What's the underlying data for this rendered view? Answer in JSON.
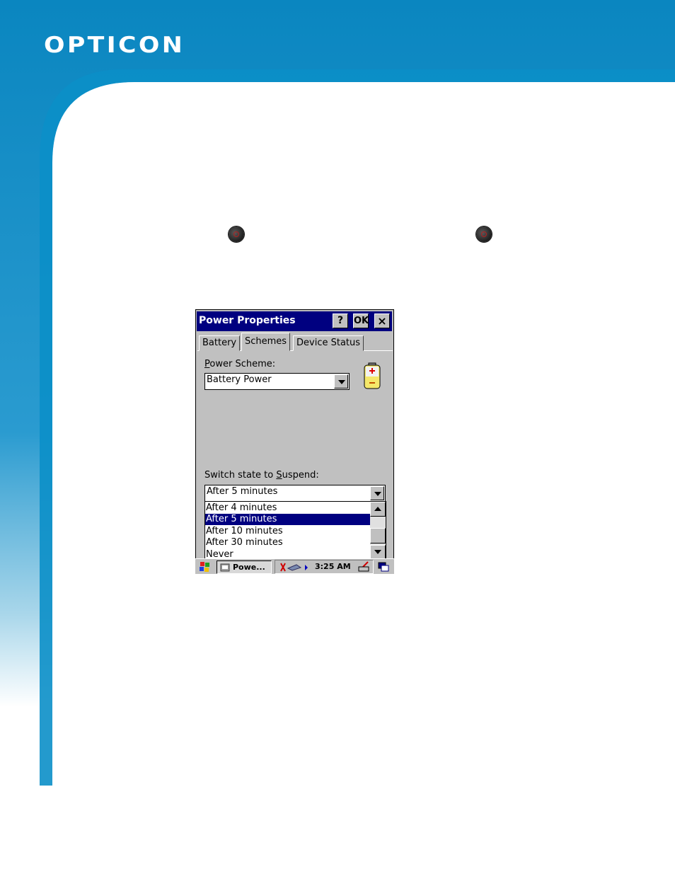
{
  "brand": {
    "logo_text": "OPTICON",
    "primary_color": "#1f8bc2",
    "dark_color": "#0a78b5"
  },
  "window": {
    "title": "Power Properties",
    "help_button": "?",
    "ok_button": "OK",
    "close_button": "×"
  },
  "tabs": [
    {
      "label": "Battery",
      "active": false
    },
    {
      "label": "Schemes",
      "active": true
    },
    {
      "label": "Device Status",
      "active": false
    }
  ],
  "power_scheme": {
    "label_prefix": "",
    "label_hotkey": "P",
    "label_rest": "ower Scheme:",
    "value": "Battery Power",
    "icon": "battery-icon"
  },
  "suspend": {
    "label_prefix": "Switch state to ",
    "label_hotkey": "S",
    "label_rest": "uspend:",
    "value": "After 5 minutes",
    "options": [
      "After 4 minutes",
      "After 5 minutes",
      "After 10 minutes",
      "After 30 minutes",
      "Never"
    ],
    "selected_index": 1
  },
  "taskbar": {
    "start_icon": "windows-flag-icon",
    "task_label": "Powe...",
    "clock": "3:25 AM"
  }
}
